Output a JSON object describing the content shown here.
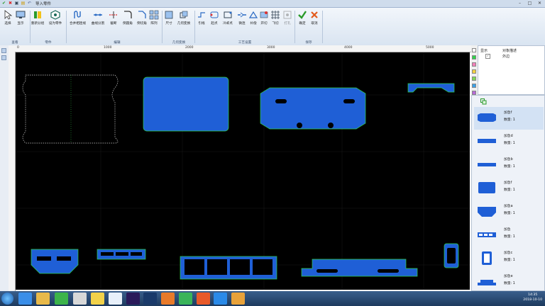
{
  "window": {
    "title": "导入零件",
    "min_icon": "minimize-icon",
    "max_icon": "maximize-icon",
    "close_icon": "close-icon"
  },
  "ribbon": {
    "groups": [
      {
        "label": "查看"
      },
      {
        "label": "零件"
      },
      {
        "label": "编辑"
      },
      {
        "label": "几何变换"
      },
      {
        "label": "工艺设置"
      },
      {
        "label": "保存"
      }
    ],
    "buttons": {
      "select": "选择",
      "display": "显示",
      "regroup": "重新分组",
      "set_part": "设为零件",
      "merge_lines": "合并相连线",
      "curve_split": "曲线分割",
      "break": "截断",
      "fillet": "倒圆角",
      "chamfer": "倒切角",
      "array": "阵列",
      "size": "尺寸",
      "geo_transform": "几何变换",
      "lead": "引线",
      "start_point": "起点",
      "cooling_point": "冷却点",
      "micro_joint": "微连",
      "compensation": "补偿",
      "open": "开切",
      "fly_cut": "飞切",
      "punch": "打孔",
      "confirm": "确定",
      "cancel": "取消"
    }
  },
  "ruler": {
    "top": [
      "0",
      "1000",
      "2000",
      "3000",
      "4000",
      "5000"
    ]
  },
  "layers": {
    "col_display": "显示",
    "col_layer": "对象描述",
    "row_name": "外边"
  },
  "parts": [
    {
      "name": "加急f",
      "qty_label": "数量: 1"
    },
    {
      "name": "加急d",
      "qty_label": "数量: 1"
    },
    {
      "name": "加急b",
      "qty_label": "数量: 1"
    },
    {
      "name": "加急f",
      "qty_label": "数量: 1"
    },
    {
      "name": "加急a",
      "qty_label": "数量: 1"
    },
    {
      "name": "加急",
      "qty_label": "数量: 1"
    },
    {
      "name": "加急c",
      "qty_label": "数量: 1"
    },
    {
      "name": "加急e",
      "qty_label": "数量: 1"
    }
  ],
  "taskbar": {
    "time": "14:35",
    "date": "2018-10-10"
  },
  "colors": {
    "part_fill": "#1f5fd6",
    "outline": "#2fd34a",
    "canvas_bg": "#000000"
  }
}
